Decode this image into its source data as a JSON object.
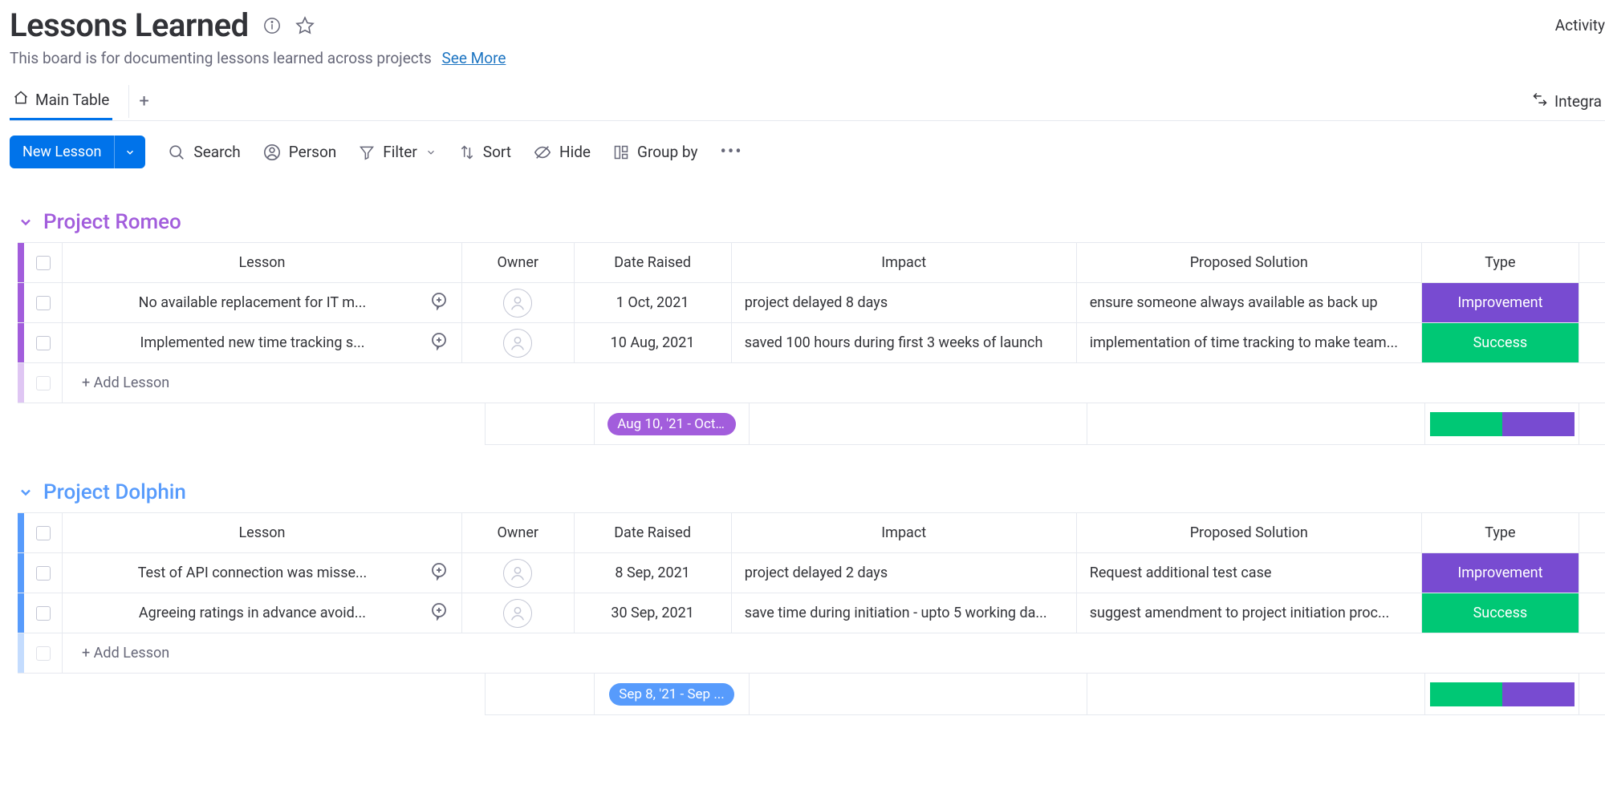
{
  "header": {
    "title": "Lessons Learned",
    "description": "This board is for documenting lessons learned across projects",
    "see_more": "See More",
    "activity": "Activity"
  },
  "tabs": {
    "main": "Main Table",
    "integrate": "Integra"
  },
  "toolbar": {
    "new_lesson": "New Lesson",
    "search": "Search",
    "person": "Person",
    "filter": "Filter",
    "sort": "Sort",
    "hide": "Hide",
    "group_by": "Group by"
  },
  "columns": {
    "lesson": "Lesson",
    "owner": "Owner",
    "date": "Date Raised",
    "impact": "Impact",
    "solution": "Proposed Solution",
    "type": "Type"
  },
  "add_lesson": "+ Add Lesson",
  "groups": [
    {
      "name": "Project Romeo",
      "class": "romeo",
      "summary_date": "Aug 10, '21 - Oct...",
      "rows": [
        {
          "lesson": "No available replacement for IT m...",
          "date": "1 Oct, 2021",
          "impact": "project delayed 8 days",
          "solution": "ensure someone always available as back up",
          "type": "Improvement",
          "type_class": "type-improvement"
        },
        {
          "lesson": "Implemented new time tracking s...",
          "date": "10 Aug, 2021",
          "impact": "saved 100 hours during first 3 weeks of launch",
          "solution": "implementation of time tracking to make team...",
          "type": "Success",
          "type_class": "type-success"
        }
      ]
    },
    {
      "name": "Project Dolphin",
      "class": "dolphin",
      "summary_date": "Sep 8, '21 - Sep ...",
      "rows": [
        {
          "lesson": "Test of API connection was misse...",
          "date": "8 Sep, 2021",
          "impact": "project delayed 2 days",
          "solution": "Request additional test case",
          "type": "Improvement",
          "type_class": "type-improvement"
        },
        {
          "lesson": "Agreeing ratings in advance avoid...",
          "date": "30 Sep, 2021",
          "impact": "save time during initiation - upto 5 working da...",
          "solution": "suggest amendment to project initiation proc...",
          "type": "Success",
          "type_class": "type-success"
        }
      ]
    }
  ]
}
